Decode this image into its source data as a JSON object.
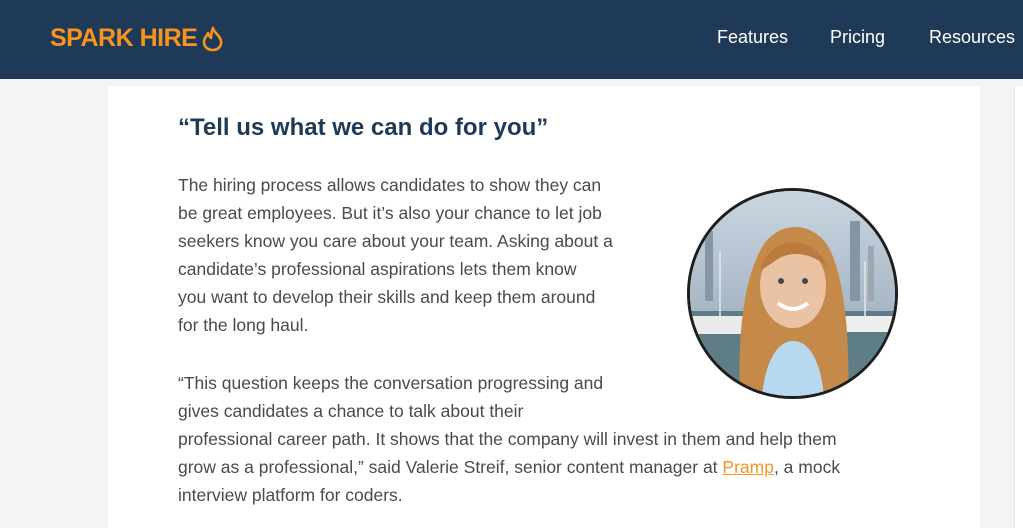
{
  "brand": {
    "name": "SPARK HIRE",
    "color": "#f7941e",
    "icon": "flame-icon"
  },
  "nav": {
    "background": "#1f3a57",
    "items": [
      "Features",
      "Pricing",
      "Resources"
    ]
  },
  "article": {
    "title": "“Tell us what we can do for you”",
    "paragraph1_lines": [
      "The hiring process allows candidates to show they can",
      "be great employees. But it’s also your chance to let job",
      "seekers know you care about your team. Asking about a",
      "candidate’s professional aspirations lets them know",
      "you want to develop their skills and keep them around",
      "for the long haul."
    ],
    "paragraph2_lines": [
      "“This question keeps the conversation progressing and",
      "gives candidates a chance to talk about their",
      "professional career path. It shows that the company will invest in them and help them"
    ],
    "paragraph2_line4_before": "grow as a professional,” said Valerie Streif, senior content manager at ",
    "paragraph2_link": "Pramp",
    "paragraph2_line4_after": ", a mock",
    "paragraph2_line5": "interview platform for coders.",
    "photo_icon": "portrait-photo"
  }
}
